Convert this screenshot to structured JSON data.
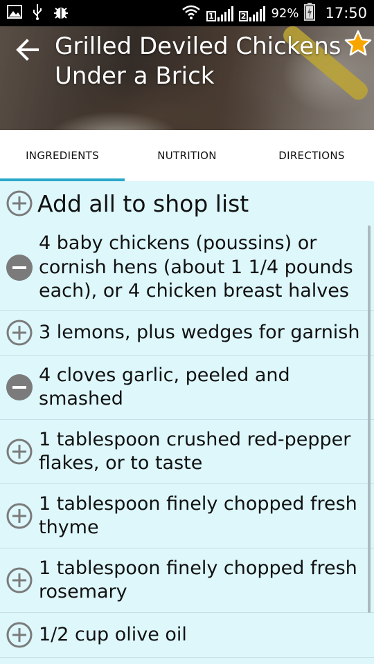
{
  "status_bar": {
    "sim1_label": "1",
    "sim2_label": "2",
    "battery": "92%",
    "time": "17:50",
    "icons": [
      "image-icon",
      "usb-icon",
      "debug-icon",
      "wifi-icon",
      "signal-icon",
      "battery-charging-icon"
    ]
  },
  "header": {
    "title": "Grilled Deviled Chickens Under a Brick",
    "back_icon": "arrow-back-icon",
    "favorite_icon": "star-icon",
    "accent_color": "#f7a600"
  },
  "tabs": [
    {
      "label": "INGREDIENTS",
      "active": true
    },
    {
      "label": "NUTRITION",
      "active": false
    },
    {
      "label": "DIRECTIONS",
      "active": false
    }
  ],
  "add_all": {
    "label": "Add all to shop list",
    "icon": "plus-circle-icon"
  },
  "ingredients": [
    {
      "text": "4 baby chickens (poussins) or cornish hens (about 1 1/4 pounds each), or 4 chicken breast halves",
      "icon": "minus-circle-icon"
    },
    {
      "text": "3 lemons, plus wedges for garnish",
      "icon": "plus-circle-icon"
    },
    {
      "text": "4 cloves garlic, peeled and smashed",
      "icon": "minus-circle-icon"
    },
    {
      "text": "1 tablespoon crushed red-pepper flakes, or to taste",
      "icon": "plus-circle-icon"
    },
    {
      "text": "1 tablespoon finely chopped fresh thyme",
      "icon": "plus-circle-icon"
    },
    {
      "text": "1 tablespoon finely chopped fresh rosemary",
      "icon": "plus-circle-icon"
    },
    {
      "text": "1/2 cup olive oil",
      "icon": "plus-circle-icon"
    }
  ],
  "colors": {
    "list_background": "#ddf7fb",
    "tab_indicator": "#2aa8c9",
    "icon_gray": "#7b7b7b"
  }
}
